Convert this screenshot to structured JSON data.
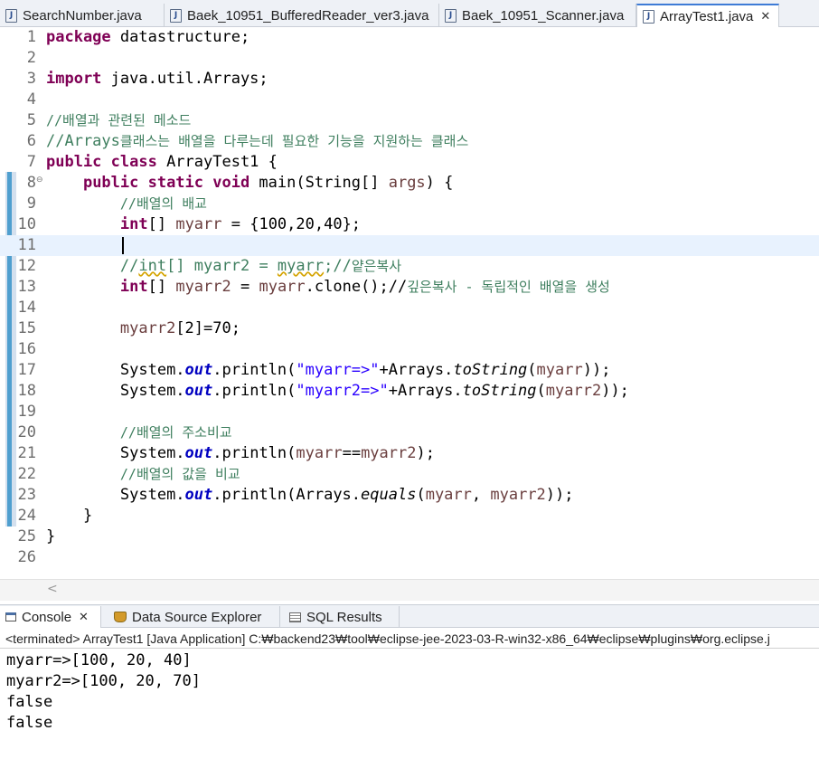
{
  "editor_tabs": [
    {
      "label": "SearchNumber.java",
      "active": false
    },
    {
      "label": "Baek_10951_BufferedReader_ver3.java",
      "active": false
    },
    {
      "label": "Baek_10951_Scanner.java",
      "active": false
    },
    {
      "label": "ArrayTest1.java",
      "active": true
    }
  ],
  "code": {
    "l1": {
      "kw": "package",
      "rest": " datastructure;"
    },
    "l3": {
      "kw": "import",
      "rest": " java.util.Arrays;"
    },
    "l5": {
      "comment": "//배열과 관련된 메소드"
    },
    "l6": {
      "prefix": "//Arrays",
      "comment": "클래스는 배열을 다루는데 필요한 기능을 지원하는 클래스"
    },
    "l7": {
      "kw": "public class",
      "rest": " ArrayTest1 {"
    },
    "l8": {
      "kw": "public static void",
      "rest": " main(String[] ",
      "arg": "args",
      "end": ") {"
    },
    "l9": {
      "comment": "//배열의 배교"
    },
    "l10": {
      "kw": "int",
      "rest": "[] ",
      "var": "myarr",
      "end": " = {100,20,40};"
    },
    "l12": {
      "a": "//",
      "b": "int",
      "c": "[] myarr2 = ",
      "d": "myarr",
      "e": ";//",
      "comment": "얕은복사"
    },
    "l13": {
      "kw": "int",
      "rest": "[] ",
      "var": "myarr2",
      "mid": " = ",
      "var2": "myarr",
      "end": ".clone();//",
      "comment": "깊은복사 - 독립적인 배열을 생성"
    },
    "l15": {
      "var": "myarr2",
      "end": "[2]=70;"
    },
    "l17": {
      "a": "System.",
      "fld": "out",
      "b": ".println(",
      "str": "\"myarr=>\"",
      "c": "+Arrays.",
      "m": "toString",
      "d": "(",
      "var": "myarr",
      "e": "));"
    },
    "l18": {
      "a": "System.",
      "fld": "out",
      "b": ".println(",
      "str": "\"myarr2=>\"",
      "c": "+Arrays.",
      "m": "toString",
      "d": "(",
      "var": "myarr2",
      "e": "));"
    },
    "l20": {
      "comment": "//배열의 주소비교"
    },
    "l21": {
      "a": "System.",
      "fld": "out",
      "b": ".println(",
      "var": "myarr",
      "c": "==",
      "var2": "myarr2",
      "e": ");"
    },
    "l22": {
      "comment": "//배열의 값을 비교"
    },
    "l23": {
      "a": "System.",
      "fld": "out",
      "b": ".println(Arrays.",
      "m": "equals",
      "c": "(",
      "var": "myarr",
      "d": ", ",
      "var2": "myarr2",
      "e": "));"
    },
    "l24": {
      "text": "}"
    },
    "l25": {
      "text": "}"
    }
  },
  "line_numbers": [
    "1",
    "2",
    "3",
    "4",
    "5",
    "6",
    "7",
    "8",
    "9",
    "10",
    "11",
    "12",
    "13",
    "14",
    "15",
    "16",
    "17",
    "18",
    "19",
    "20",
    "21",
    "22",
    "23",
    "24",
    "25",
    "26"
  ],
  "fold_marker": "⊖",
  "hscroll_arrow": "<",
  "console_tabs": [
    {
      "label": "Console",
      "close": "✕"
    },
    {
      "label": "Data Source Explorer"
    },
    {
      "label": "SQL Results"
    }
  ],
  "console_info": "<terminated> ArrayTest1 [Java Application] C:₩backend23₩tool₩eclipse-jee-2023-03-R-win32-x86_64₩eclipse₩plugins₩org.eclipse.j",
  "console_output": [
    "myarr=>[100, 20, 40]",
    "myarr2=>[100, 20, 70]",
    "false",
    "false"
  ],
  "close_icon": "✕"
}
